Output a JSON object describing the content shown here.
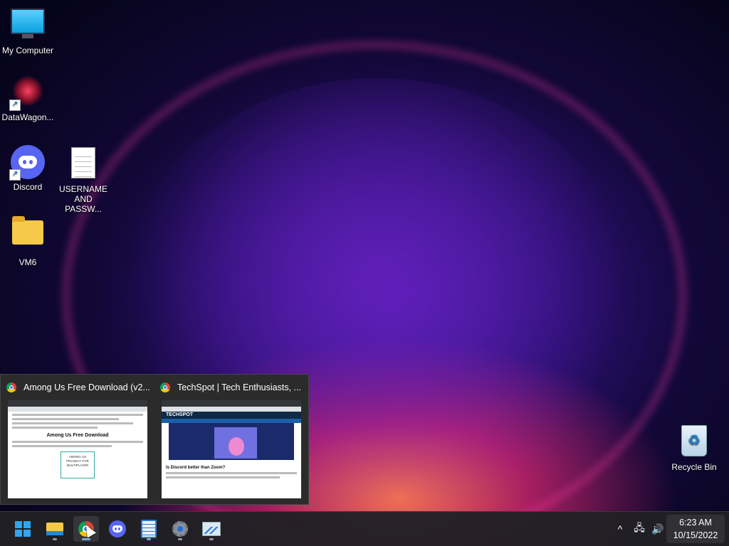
{
  "desktop_icons": [
    {
      "label": "My Computer",
      "icon": "monitor-icon"
    },
    {
      "label": "DataWagon...",
      "icon": "datawagon-icon"
    },
    {
      "label": "Discord",
      "icon": "discord-icon"
    },
    {
      "label_line1": "USERNAME",
      "label_line2": "AND PASSW...",
      "icon": "text-document-icon"
    },
    {
      "label": "VM6",
      "icon": "folder-icon"
    },
    {
      "label": "Recycle Bin",
      "icon": "recycle-bin-icon"
    }
  ],
  "preview": {
    "items": [
      {
        "title": "Among Us Free Download (v2...",
        "page_heading": "Among Us Free Download",
        "box_text": "AMONG US PROJECT FOR MULTIPLAYER"
      },
      {
        "title": "TechSpot | Tech Enthusiasts, ...",
        "site_name": "TECHSPOT",
        "question": "Is Discord better than Zoom?"
      }
    ]
  },
  "taskbar": {
    "apps": [
      "start-button",
      "file-explorer",
      "chrome",
      "discord",
      "notepad",
      "settings",
      "resource-monitor"
    ],
    "clock": {
      "time": "6:23 AM",
      "date": "10/15/2022"
    }
  }
}
